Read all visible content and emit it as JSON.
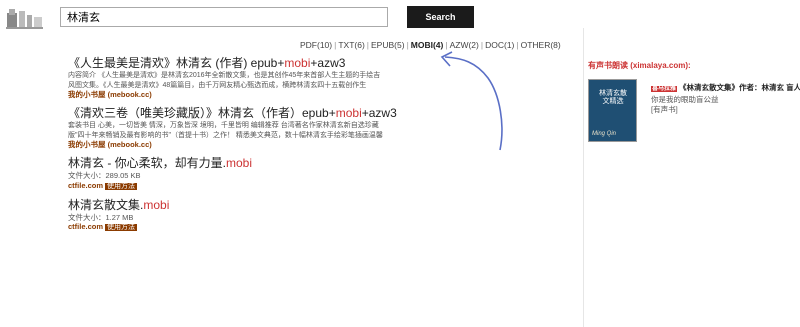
{
  "search": {
    "value": "林清玄",
    "button_label": "Search"
  },
  "filters": [
    {
      "label": "PDF(10)",
      "active": false
    },
    {
      "label": "TXT(6)",
      "active": false
    },
    {
      "label": "EPUB(5)",
      "active": false
    },
    {
      "label": "MOBI(4)",
      "active": true
    },
    {
      "label": "AZW(2)",
      "active": false
    },
    {
      "label": "DOC(1)",
      "active": false
    },
    {
      "label": "OTHER(8)",
      "active": false
    }
  ],
  "filter_separator": "|",
  "results": [
    {
      "title_pre": "《人生最美是清欢》林清玄 (作者) epub+",
      "title_hl": "mobi",
      "title_post": "+azw3",
      "desc": "内容简介 《人生最美是清欢》是林清玄2016年全新散文集，也是其创作45年来首部人生主题的手绘吉风图文集。《人生最美是清欢》48篇篇目，由千万网友精心甄选而成，横跨林清玄四十五载创作生",
      "source": "我的小书屋 (mebook.cc)"
    },
    {
      "title_pre": "《清欢三卷（唯美珍藏版）》林清玄（作者）epub+",
      "title_hl": "mobi",
      "title_post": "+azw3",
      "desc": "套装书目 心美，一切皆美 情深，万象皆深 境明，千里皆明 编辑推荐 台湾著名作家林清玄新自选珍藏版\"四十年来畅销及最有影响的书\"（首提十书）之作！ 精悉美文典范，数十幅林清玄手绘彩笔插画温馨",
      "source": "我的小书屋 (mebook.cc)"
    },
    {
      "title_pre": "林清玄 - 你心柔软，却有力量.",
      "title_hl": "mobi",
      "title_post": "",
      "size": "文件大小：289.05 KB",
      "site": "ctfile.com",
      "badge": "使用方法"
    },
    {
      "title_pre": "林清玄散文集.",
      "title_hl": "mobi",
      "title_post": "",
      "size": "文件大小：1.27 MB",
      "site": "ctfile.com",
      "badge": "使用方法"
    }
  ],
  "sidebar": {
    "heading": "有声书朗读 (ximalaya.com):",
    "book": {
      "tag": "喜马拉雅",
      "title": "《林清玄散文集》作者：林清玄 盲人",
      "line1": "你是我的眼助盲公益",
      "line2": "[有声书]",
      "cover_title": "林清玄散文精选",
      "cover_sub": "Ming Qin"
    }
  }
}
